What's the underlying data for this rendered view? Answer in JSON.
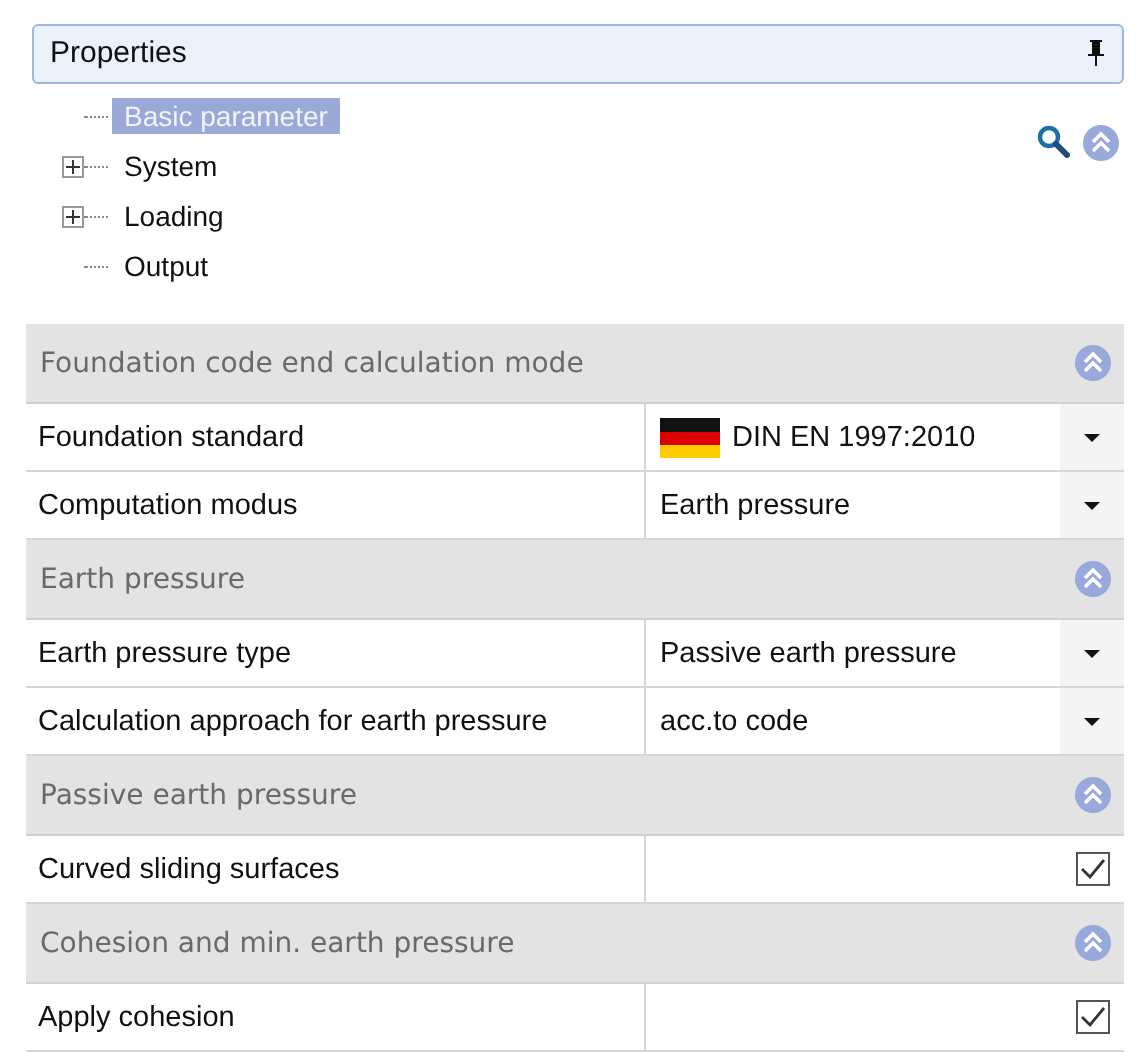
{
  "panel": {
    "title": "Properties",
    "pinned": true
  },
  "tree": [
    {
      "label": "Basic parameter",
      "kind": "leaf",
      "selected": true
    },
    {
      "label": "System",
      "kind": "node",
      "selected": false,
      "expanded": false
    },
    {
      "label": "Loading",
      "kind": "node",
      "selected": false,
      "expanded": false
    },
    {
      "label": "Output",
      "kind": "leaf",
      "selected": false
    }
  ],
  "grid": [
    {
      "kind": "section",
      "label": "Foundation code end calculation mode",
      "expanded": true
    },
    {
      "kind": "flag-dropdown",
      "label": "Foundation standard",
      "value": "DIN EN 1997:2010"
    },
    {
      "kind": "dropdown",
      "label": "Computation modus",
      "value": "Earth pressure"
    },
    {
      "kind": "section",
      "label": "Earth pressure",
      "expanded": true
    },
    {
      "kind": "dropdown",
      "label": "Earth pressure type",
      "value": "Passive earth pressure"
    },
    {
      "kind": "dropdown",
      "label": "Calculation approach for earth pressure",
      "value": "acc.to code"
    },
    {
      "kind": "section",
      "label": "Passive earth pressure",
      "expanded": true
    },
    {
      "kind": "checkbox",
      "label": "Curved sliding surfaces",
      "checked": true
    },
    {
      "kind": "section",
      "label": "Cohesion and min. earth pressure",
      "expanded": true
    },
    {
      "kind": "checkbox",
      "label": "Apply cohesion",
      "checked": true
    }
  ]
}
